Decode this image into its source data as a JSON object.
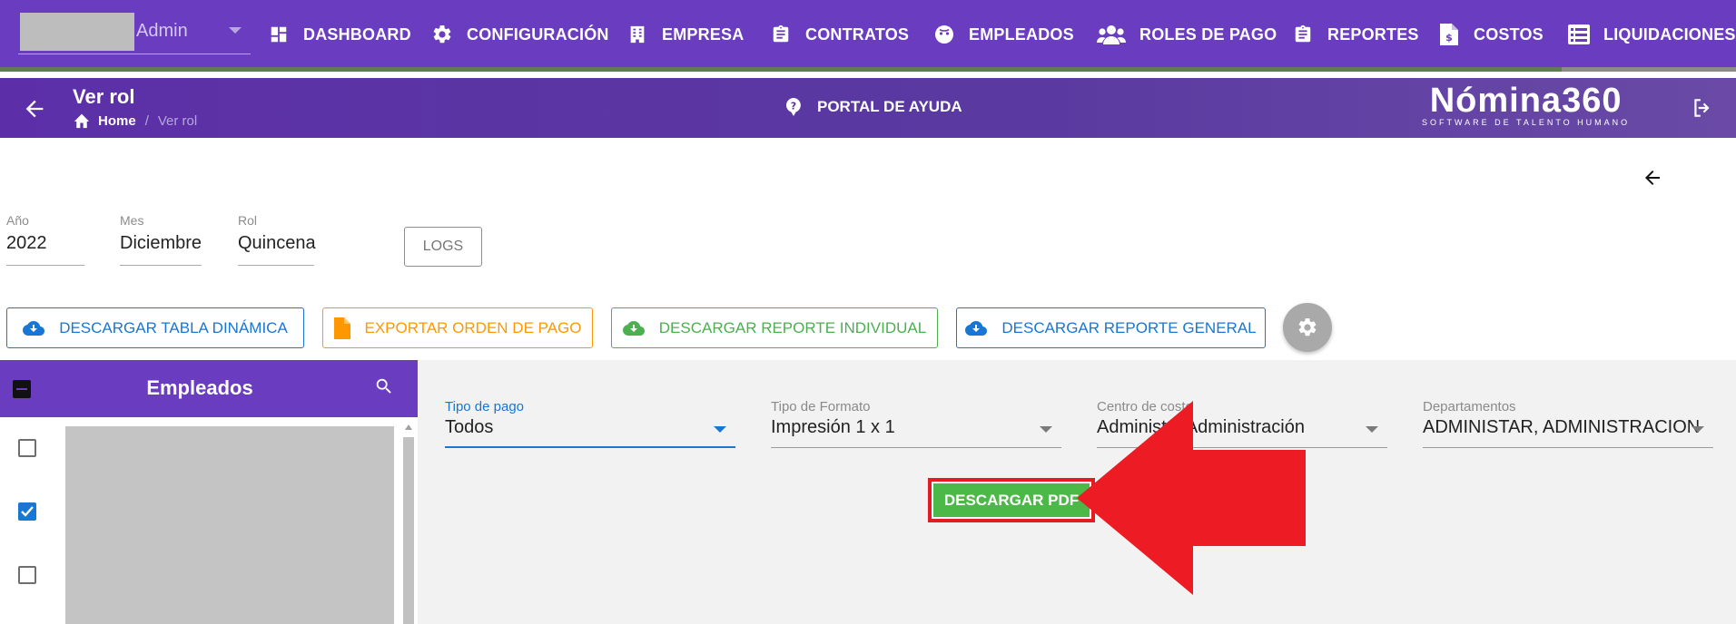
{
  "topnav": {
    "user": {
      "name": "Admin"
    },
    "items": [
      {
        "label": "DASHBOARD",
        "icon": "dashboard-icon"
      },
      {
        "label": "CONFIGURACIÓN",
        "icon": "gear-icon"
      },
      {
        "label": "EMPRESA",
        "icon": "building-icon"
      },
      {
        "label": "CONTRATOS",
        "icon": "clipboard-icon"
      },
      {
        "label": "EMPLEADOS",
        "icon": "face-icon"
      },
      {
        "label": "ROLES DE PAGO",
        "icon": "group-icon"
      },
      {
        "label": "REPORTES",
        "icon": "report-clipboard-icon"
      },
      {
        "label": "COSTOS",
        "icon": "invoice-dollar-icon"
      },
      {
        "label": "LIQUIDACIONES",
        "icon": "list-icon"
      }
    ]
  },
  "subheader": {
    "title": "Ver rol",
    "breadcrumb": {
      "home": "Home",
      "separator": "/",
      "current": "Ver rol"
    },
    "help_label": "PORTAL DE AYUDA",
    "logo": {
      "main": "Nómina360",
      "tagline": "SOFTWARE DE TALENTO HUMANO"
    }
  },
  "filters_top": {
    "year": {
      "label": "Año",
      "value": "2022"
    },
    "month": {
      "label": "Mes",
      "value": "Diciembre"
    },
    "role": {
      "label": "Rol",
      "value": "Quincena"
    },
    "logs_label": "LOGS"
  },
  "actions": {
    "pivot_label": "DESCARGAR TABLA DINÁMICA",
    "export_order_label": "EXPORTAR ORDEN DE PAGO",
    "individual_report_label": "DESCARGAR REPORTE INDIVIDUAL",
    "general_report_label": "DESCARGAR REPORTE GENERAL"
  },
  "employees": {
    "title": "Empleados",
    "rows": [
      {
        "checked": false
      },
      {
        "checked": true
      },
      {
        "checked": false
      }
    ]
  },
  "report_filters": {
    "payment_type": {
      "label": "Tipo de pago",
      "value": "Todos"
    },
    "format_type": {
      "label": "Tipo de Formato",
      "value": "Impresión 1 x 1"
    },
    "cost_center": {
      "label": "Centro de costo",
      "value": "Administ... Administración"
    },
    "departments": {
      "label": "Departamentos",
      "value": "ADMINISTAR, ADMINISTRACION"
    }
  },
  "download_pdf_label": "DESCARGAR PDF",
  "colors": {
    "primary": "#6a3cc0",
    "blue": "#1976d2",
    "orange": "#ff9800",
    "green": "#4caf50",
    "annotation_red": "#e31b23"
  }
}
